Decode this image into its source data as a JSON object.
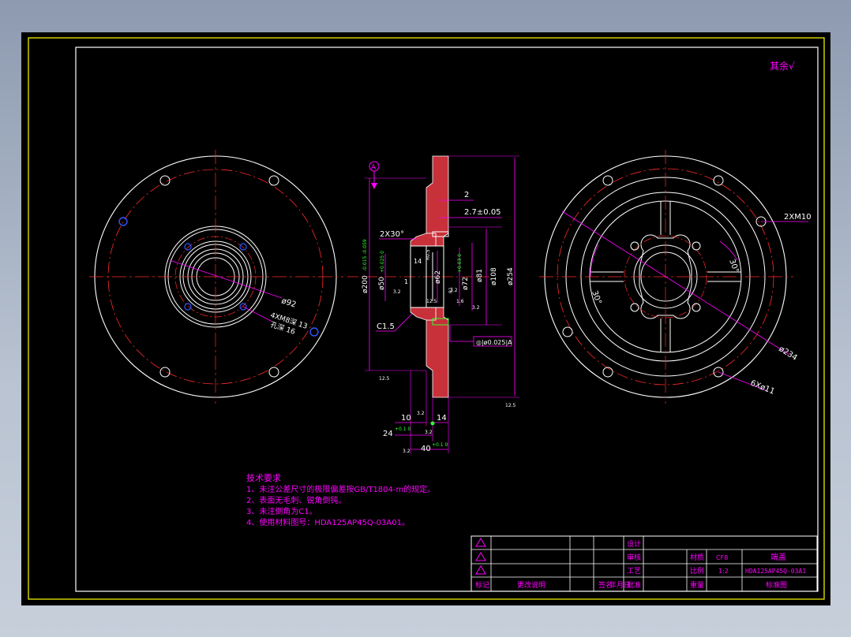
{
  "colors": {
    "background": "#000000",
    "outer_frame": "#ffff00",
    "lines": "#ffffff",
    "center_lines": "#ff2a2a",
    "dimensions": "#ff00ff",
    "tolerances": "#33ff33",
    "holes": "#3355ff",
    "section_fill": "#ff4d4d"
  },
  "corner_note": "其余√",
  "datum": "A",
  "left_view": {
    "dim_hole_circle": "ø92",
    "note_tap_line1": "4XM8深 13",
    "note_tap_line2": "孔深 16"
  },
  "section_view": {
    "dim_2": "2",
    "dim_2_7": "2.7±0.05",
    "dim_chamfer": "2X30°",
    "dim_14a": "14",
    "dim_1": "1",
    "dim_r05": "R0.5",
    "dim_r1": "R1",
    "dim_c15": "C1.5",
    "dim_d200": "ø200",
    "dim_d200_tol": "-0.015 -0.059",
    "dim_d50": "ø50",
    "dim_d50_tol": "+0.025 0",
    "dim_d62": "ø62",
    "dim_d72": "ø72",
    "dim_d72_tol": "+0.03 0",
    "dim_d81": "ø81",
    "dim_d108": "ø108",
    "dim_d254": "ø254",
    "dim_12_5": "12.5",
    "dim_3_2a": "3.2",
    "dim_1_6": "1.6",
    "dim_3_2b": "3.2",
    "dim_3_2c": "3.2",
    "dim_12_5b": "12.5",
    "dim_12_5c": "12.5",
    "tolerance_frame": "◎|ø0.025|A",
    "dim_10": "10",
    "dim_14b": "14",
    "dim_24": "24",
    "dim_24_tol": "+0.1 0",
    "dim_40": "40",
    "dim_40_tol": "+0.1 0",
    "dim_3_2d": "3.2",
    "dim_3_2e": "3.2",
    "dim_3_2f": "3.2"
  },
  "right_view": {
    "note_2xm10": "2XM10",
    "angle_1": "30°",
    "angle_2": "30°",
    "dim_234": "ø234",
    "note_6x11": "6Xø11"
  },
  "tech": {
    "title": "技术要求",
    "items": [
      "1、未注公差尺寸的极限偏差按GB/T1804-m的规定。",
      "2、表面无毛刺、锐角倒钝。",
      "3、未注倒角为C1。",
      "4、使用材料图号：HDA125AP45Q-03A01。"
    ]
  },
  "title_block": {
    "rev_labels": [
      "标记",
      "更改说明",
      "签名",
      "年月日"
    ],
    "design": "设计",
    "check": "审核",
    "process": "工艺",
    "approve": "批准",
    "material_label": "材质",
    "material": "CF8",
    "scale_label": "比例",
    "scale": "1:2",
    "weight_label": "重量",
    "part_name": "端盖",
    "drawing_no": "HDA125AP45Q-03A1",
    "standard": "标准图"
  }
}
